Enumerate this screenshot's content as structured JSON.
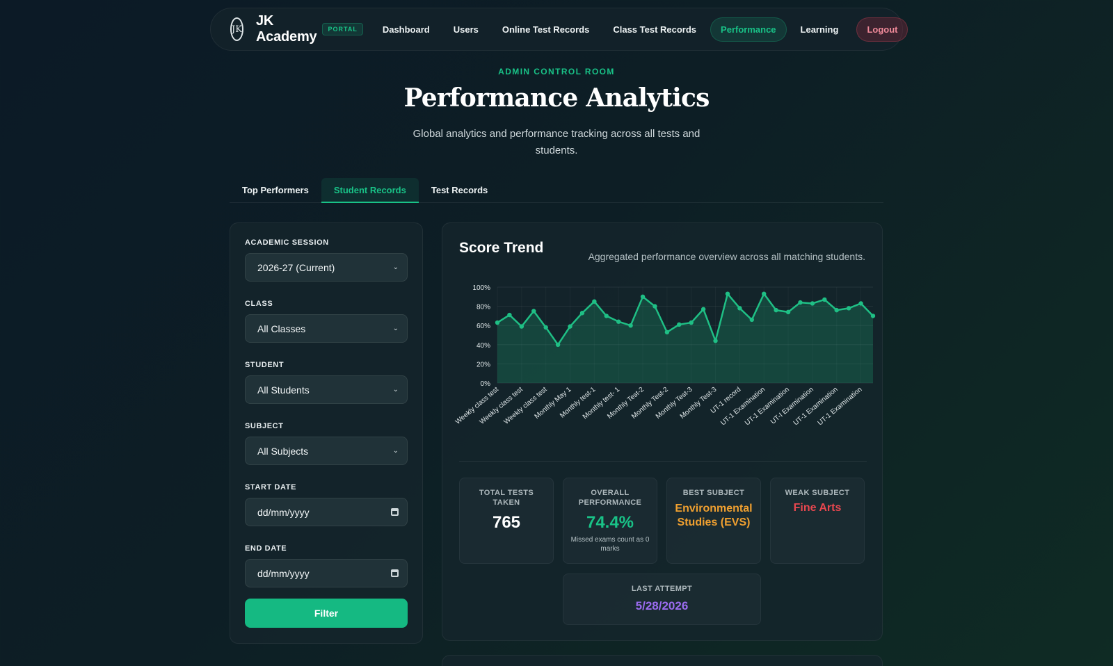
{
  "nav": {
    "logo_text": "JK",
    "brand": "JK Academy",
    "badge": "PORTAL",
    "items": [
      {
        "label": "Dashboard"
      },
      {
        "label": "Users"
      },
      {
        "label": "Online Test Records"
      },
      {
        "label": "Class Test Records"
      },
      {
        "label": "Performance",
        "active": true
      },
      {
        "label": "Learning"
      }
    ],
    "logout": "Logout"
  },
  "header": {
    "eyebrow": "ADMIN CONTROL ROOM",
    "title": "Performance Analytics",
    "subtitle": "Global analytics and performance tracking across all tests and students."
  },
  "tabs": [
    {
      "label": "Top Performers"
    },
    {
      "label": "Student Records",
      "active": true
    },
    {
      "label": "Test Records"
    }
  ],
  "filters": {
    "session": {
      "label": "ACADEMIC SESSION",
      "value": "2026-27 (Current)"
    },
    "class": {
      "label": "CLASS",
      "value": "All Classes"
    },
    "student": {
      "label": "STUDENT",
      "value": "All Students"
    },
    "subject": {
      "label": "SUBJECT",
      "value": "All Subjects"
    },
    "start_date": {
      "label": "START DATE",
      "placeholder": "dd/mm/yyyy"
    },
    "end_date": {
      "label": "END DATE",
      "placeholder": "dd/mm/yyyy"
    },
    "button": "Filter"
  },
  "trend": {
    "title": "Score Trend",
    "description": "Aggregated performance overview across all matching students."
  },
  "chart_data": {
    "type": "area",
    "ylim": [
      0,
      100
    ],
    "yticks": [
      "0%",
      "20%",
      "40%",
      "60%",
      "80%",
      "100%"
    ],
    "categories": [
      "Weekly class test",
      "Weekly class test",
      "Weekly class test",
      "Monthly May 1",
      "Monthly test-1",
      "Monthly test- 1",
      "Monthly Test-2",
      "Monthly Test-2",
      "Monthly Test-3",
      "Monthly Test-3",
      "UT-1 record",
      "UT-1 Examination",
      "UT-1 Examination",
      "UT-I Examination",
      "UT-1 Examination",
      "UT-1 Examination"
    ],
    "values": [
      63,
      71,
      59,
      75,
      58,
      40,
      59,
      73,
      85,
      70,
      64,
      60,
      90,
      80,
      53,
      61,
      63,
      77,
      44,
      93,
      78,
      66,
      93,
      76,
      74,
      84,
      83,
      87,
      76,
      78,
      83,
      70
    ],
    "grid": true,
    "colors": {
      "line": "#1fbf85",
      "fill": "#1fbf85"
    }
  },
  "stats": {
    "total": {
      "label": "TOTAL TESTS TAKEN",
      "value": "765"
    },
    "overall": {
      "label": "OVERALL PERFORMANCE",
      "value": "74.4%",
      "note": "Missed exams count as 0 marks"
    },
    "best": {
      "label": "BEST SUBJECT",
      "value": "Environmental Studies (EVS)"
    },
    "weak": {
      "label": "WEAK SUBJECT",
      "value": "Fine Arts"
    },
    "last": {
      "label": "LAST ATTEMPT",
      "value": "5/28/2026"
    }
  },
  "colors": {
    "accent": "#19c287",
    "orange": "#f0a030",
    "red": "#e8474f",
    "purple": "#9b6cf0"
  }
}
